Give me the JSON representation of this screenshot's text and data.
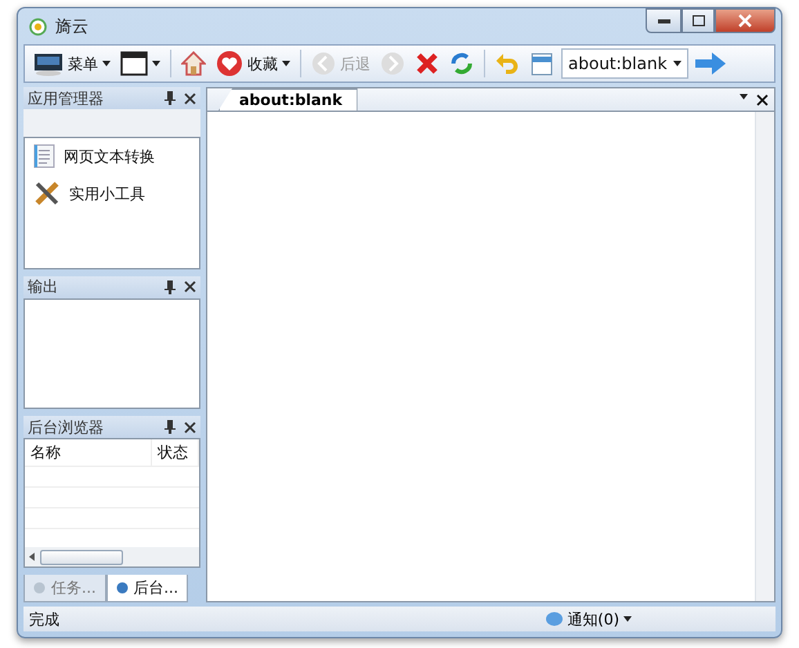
{
  "window": {
    "title": "旖云"
  },
  "toolbar": [
    {
      "kind": "menu",
      "label": "菜单",
      "dropdown": true
    },
    {
      "kind": "window",
      "dropdown": true
    },
    {
      "kind": "separator"
    },
    {
      "kind": "home"
    },
    {
      "kind": "favorites",
      "label": "收藏",
      "dropdown": true
    },
    {
      "kind": "separator"
    },
    {
      "kind": "back",
      "label": "后退",
      "disabled": true
    },
    {
      "kind": "forward",
      "disabled": true
    },
    {
      "kind": "stop",
      "disabled": false
    },
    {
      "kind": "refresh",
      "disabled": false
    },
    {
      "kind": "separator"
    },
    {
      "kind": "undo"
    },
    {
      "kind": "page"
    }
  ],
  "address": {
    "value": "about:blank"
  },
  "app_manager": {
    "title": "应用管理器",
    "items": [
      {
        "kind": "document",
        "label": "网页文本转换"
      },
      {
        "kind": "tools",
        "label": "实用小工具"
      }
    ]
  },
  "output": {
    "title": "输出"
  },
  "background_browser": {
    "title": "后台浏览器",
    "columns": [
      "名称",
      "状态"
    ]
  },
  "side_tabs": [
    {
      "label": "任务...",
      "selected": false
    },
    {
      "label": "后台...",
      "selected": true
    }
  ],
  "document_tabs": [
    {
      "label": "about:blank",
      "selected": true
    }
  ],
  "status_bar": {
    "text": "完成",
    "notification": "通知(0)"
  }
}
